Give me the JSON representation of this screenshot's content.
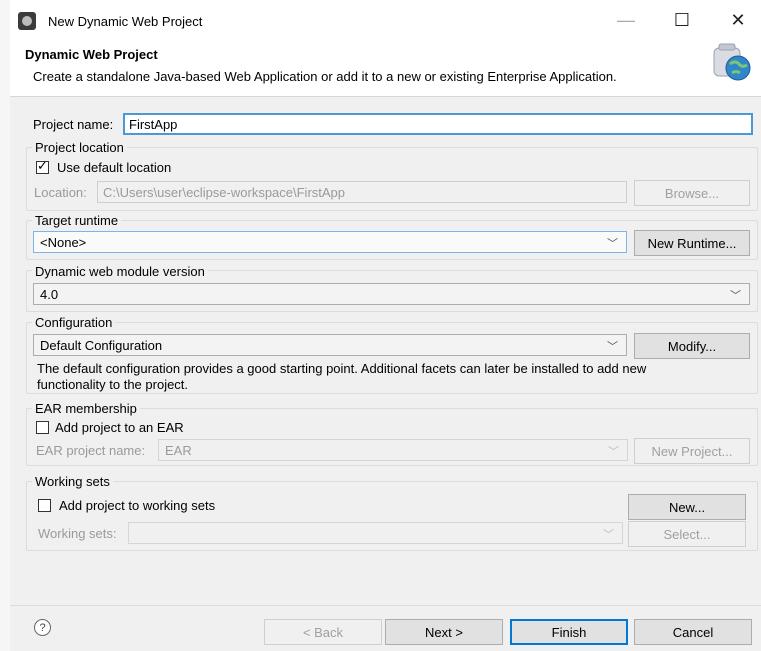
{
  "window": {
    "title": "New Dynamic Web Project",
    "minimize_glyph": "—",
    "maximize_glyph": "☐",
    "close_glyph": "✕"
  },
  "header": {
    "title": "Dynamic Web Project",
    "description": "Create a standalone Java-based Web Application or add it to a new or existing Enterprise Application."
  },
  "project_name": {
    "label": "Project name:",
    "value": "FirstApp"
  },
  "project_location": {
    "legend": "Project location",
    "use_default_label": "Use default location",
    "use_default_checked": true,
    "location_label": "Location:",
    "location_value": "C:\\Users\\user\\eclipse-workspace\\FirstApp",
    "browse_label": "Browse..."
  },
  "target_runtime": {
    "legend": "Target runtime",
    "selected": "<None>",
    "new_runtime_label": "New Runtime..."
  },
  "web_module": {
    "legend": "Dynamic web module version",
    "selected": "4.0"
  },
  "configuration": {
    "legend": "Configuration",
    "selected": "Default Configuration",
    "modify_label": "Modify...",
    "description_line1": "The default configuration provides a good starting point. Additional facets can later be installed to add new",
    "description_line2": "functionality to the project."
  },
  "ear": {
    "legend": "EAR membership",
    "add_label": "Add project to an EAR",
    "add_checked": false,
    "name_label": "EAR project name:",
    "name_value": "EAR",
    "new_project_label": "New Project..."
  },
  "working_sets": {
    "legend": "Working sets",
    "add_label": "Add project to working sets",
    "add_checked": false,
    "new_label": "New...",
    "sets_label": "Working sets:",
    "sets_value": "",
    "select_label": "Select..."
  },
  "footer": {
    "help_glyph": "?",
    "back_label": "< Back",
    "next_label": "Next >",
    "finish_label": "Finish",
    "cancel_label": "Cancel"
  },
  "icons": {
    "app": "eclipse-icon",
    "wizard": "web-project-wizard-icon",
    "help": "help-icon",
    "chevron": "chevron-down-icon",
    "check": "checkmark-icon"
  }
}
